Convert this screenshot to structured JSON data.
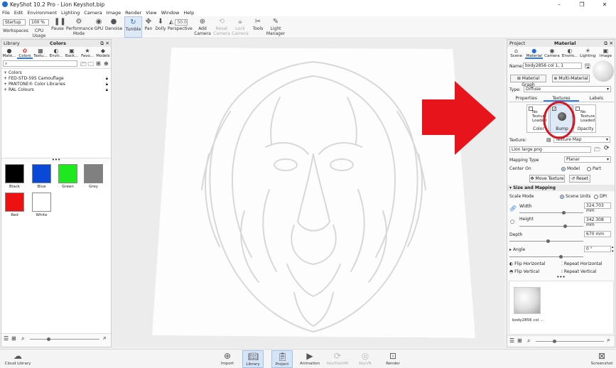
{
  "window": {
    "title": "KeyShot 10.2 Pro - Lion Keyshot.bip",
    "controls": [
      "–",
      "❐",
      "✕"
    ]
  },
  "menu": [
    "File",
    "Edit",
    "Environment",
    "Lighting",
    "Camera",
    "Image",
    "Render",
    "View",
    "Window",
    "Help"
  ],
  "toolbar": {
    "workspace_value": "Startup",
    "workspace_label": "Workspaces",
    "cpu_value": "100 %",
    "cpu_label": "CPU Usage",
    "pause": "Pause",
    "performance": "Performance Mode",
    "gpu": "GPU",
    "denoise": "Denoise",
    "tumble": "Tumble",
    "pan": "Pan",
    "dolly": "Dolly",
    "perspective_value": "50.0",
    "perspective": "Perspective",
    "add_camera": "Add Camera",
    "reset_camera": "Reset Camera",
    "lock_camera": "Lock Camera",
    "tools": "Tools",
    "light_manager": "Light Manager"
  },
  "library": {
    "title": "Library",
    "subtitle": "Colors",
    "tabs": [
      "Mate...",
      "Colors",
      "Textu...",
      "Envir...",
      "Back...",
      "Favo...",
      "Models"
    ],
    "tree": [
      "Colors",
      "FED-STD-595 Camouflage",
      "PANTONE® Color Libraries",
      "RAL Colours"
    ],
    "swatches": [
      {
        "name": "Black",
        "color": "#000000"
      },
      {
        "name": "Blue",
        "color": "#0a48d8"
      },
      {
        "name": "Green",
        "color": "#1ee81e"
      },
      {
        "name": "Grey",
        "color": "#808080"
      },
      {
        "name": "Red",
        "color": "#ee1111"
      },
      {
        "name": "White",
        "color": "#ffffff"
      }
    ]
  },
  "project": {
    "title": "Project",
    "subtitle": "Material",
    "tabs": [
      "Scene",
      "Material",
      "Camera",
      "Enviro...",
      "Lighting",
      "Image"
    ],
    "name_label": "Name:",
    "name_value": "body2856 col 1, 1",
    "material_graph": "Material Graph",
    "multi_material": "Multi-Material",
    "type_label": "Type:",
    "type_value": "Diffuse",
    "subtabs": [
      "Properties",
      "Textures",
      "Labels"
    ],
    "slots": [
      {
        "label": "Color",
        "state": "No Texture Loaded"
      },
      {
        "label": "Bump",
        "state": ""
      },
      {
        "label": "Opacity",
        "state": "No Texture Loaded"
      }
    ],
    "texture_label": "Texture:",
    "texture_value": "Texture Map",
    "file_value": "Lion large.png",
    "mapping_label": "Mapping Type",
    "mapping_value": "Planar",
    "center_label": "Center On",
    "center_model": "Model",
    "center_part": "Part",
    "move_texture": "Move Texture",
    "reset": "Reset",
    "size_mapping": "Size and Mapping",
    "scale_mode": "Scale Mode",
    "scene_units": "Scene Units",
    "dpi": "DPI",
    "width_label": "Width",
    "width_value": "324.703 mm",
    "height_label": "Height",
    "height_value": "342.308 mm",
    "depth_label": "Depth",
    "depth_value": "670 mm",
    "angle_label": "Angle",
    "angle_value": "0 °",
    "flip_h": "Flip Horizontal",
    "repeat_h": "Repeat Horizontal",
    "flip_v": "Flip Vertical",
    "repeat_v": "Repeat Vertical",
    "thumb_label": "body2856 col ..."
  },
  "bottom": {
    "cloud_library": "Cloud Library",
    "import": "Import",
    "library": "Library",
    "project": "Project",
    "animation": "Animation",
    "keyshotxr": "KeyShotXR",
    "keyvr": "KeyVR",
    "render": "Render",
    "screenshot": "Screenshot"
  },
  "colors": {
    "accent": "#2b7de9",
    "annotation_red": "#e8141c"
  }
}
